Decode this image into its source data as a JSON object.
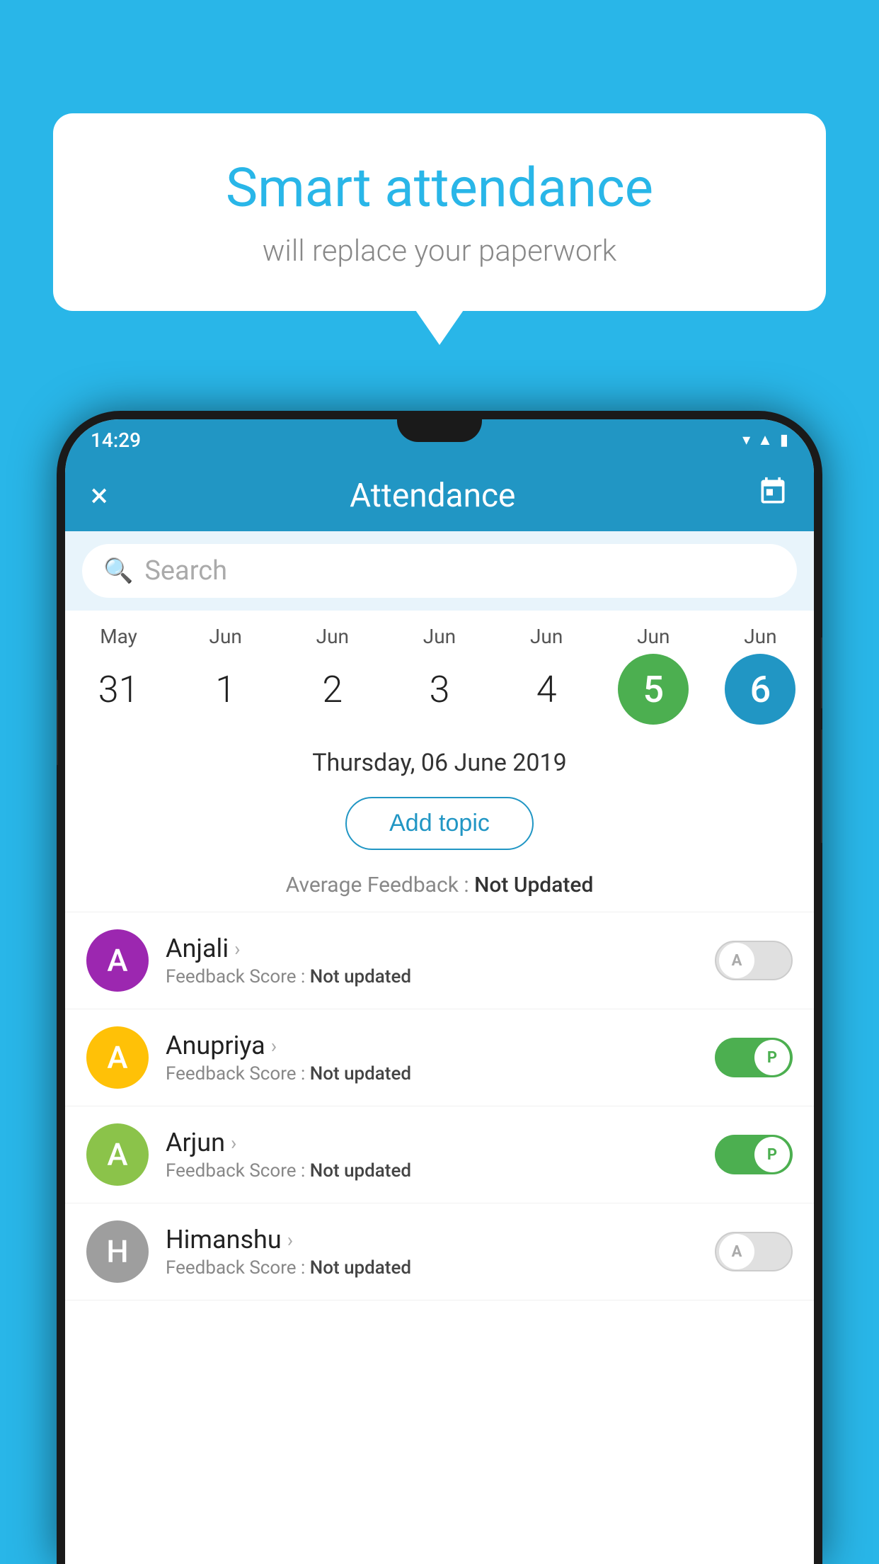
{
  "background_color": "#29B6E8",
  "bubble": {
    "title": "Smart attendance",
    "subtitle": "will replace your paperwork"
  },
  "status_bar": {
    "time": "14:29",
    "icons": [
      "wifi",
      "signal",
      "battery"
    ]
  },
  "app_bar": {
    "title": "Attendance",
    "close_label": "×",
    "calendar_label": "📅"
  },
  "search": {
    "placeholder": "Search"
  },
  "calendar": {
    "days": [
      {
        "month": "May",
        "date": "31",
        "state": "normal"
      },
      {
        "month": "Jun",
        "date": "1",
        "state": "normal"
      },
      {
        "month": "Jun",
        "date": "2",
        "state": "normal"
      },
      {
        "month": "Jun",
        "date": "3",
        "state": "normal"
      },
      {
        "month": "Jun",
        "date": "4",
        "state": "normal"
      },
      {
        "month": "Jun",
        "date": "5",
        "state": "today"
      },
      {
        "month": "Jun",
        "date": "6",
        "state": "selected"
      }
    ],
    "selected_date": "Thursday, 06 June 2019"
  },
  "add_topic": {
    "label": "Add topic"
  },
  "avg_feedback": {
    "label": "Average Feedback : ",
    "value": "Not Updated"
  },
  "students": [
    {
      "name": "Anjali",
      "avatar_letter": "A",
      "avatar_color": "#9C27B0",
      "feedback_label": "Feedback Score : ",
      "feedback_value": "Not updated",
      "toggle_state": "off",
      "toggle_letter": "A"
    },
    {
      "name": "Anupriya",
      "avatar_letter": "A",
      "avatar_color": "#FFC107",
      "feedback_label": "Feedback Score : ",
      "feedback_value": "Not updated",
      "toggle_state": "on",
      "toggle_letter": "P"
    },
    {
      "name": "Arjun",
      "avatar_letter": "A",
      "avatar_color": "#8BC34A",
      "feedback_label": "Feedback Score : ",
      "feedback_value": "Not updated",
      "toggle_state": "on",
      "toggle_letter": "P"
    },
    {
      "name": "Himanshu",
      "avatar_letter": "H",
      "avatar_color": "#9E9E9E",
      "feedback_label": "Feedback Score : ",
      "feedback_value": "Not updated",
      "toggle_state": "off",
      "toggle_letter": "A"
    }
  ]
}
